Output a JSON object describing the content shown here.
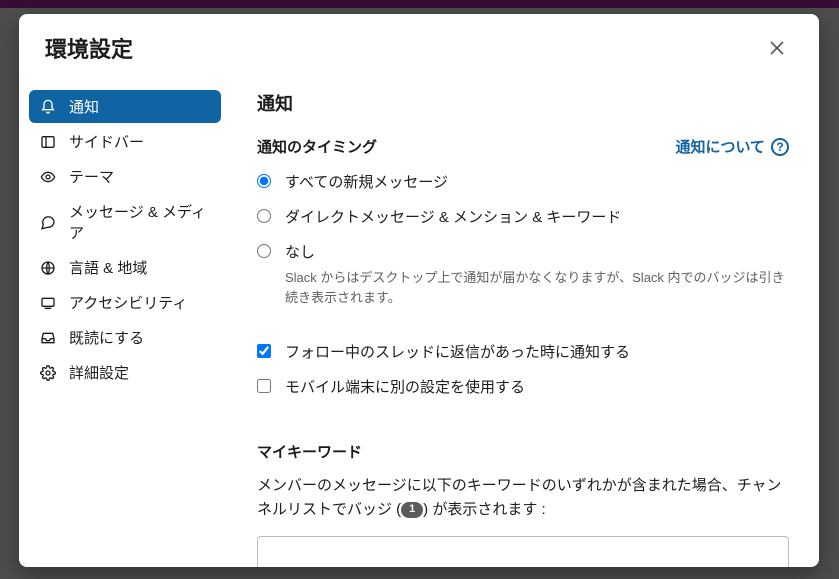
{
  "modal": {
    "title": "環境設定"
  },
  "sidebar": {
    "items": [
      {
        "label": "通知"
      },
      {
        "label": "サイドバー"
      },
      {
        "label": "テーマ"
      },
      {
        "label": "メッセージ & メディア"
      },
      {
        "label": "言語 & 地域"
      },
      {
        "label": "アクセシビリティ"
      },
      {
        "label": "既読にする"
      },
      {
        "label": "詳細設定"
      }
    ]
  },
  "content": {
    "heading": "通知",
    "timing_head": "通知のタイミング",
    "help_link": "通知について",
    "radios": {
      "all": "すべての新規メッセージ",
      "dm": "ダイレクトメッセージ & メンション & キーワード",
      "none": "なし",
      "none_sub": "Slack からはデスクトップ上で通知が届かなくなりますが、Slack 内でのバッジは引き続き表示されます。"
    },
    "checks": {
      "thread": "フォロー中のスレッドに返信があった時に通知する",
      "mobile": "モバイル端末に別の設定を使用する"
    },
    "keywords_head": "マイキーワード",
    "keywords_desc_1": "メンバーのメッセージに以下のキーワードのいずれかが含まれた場合、チャンネルリストでバッジ (",
    "keywords_badge": "1",
    "keywords_desc_2": ") が表示されます :"
  }
}
